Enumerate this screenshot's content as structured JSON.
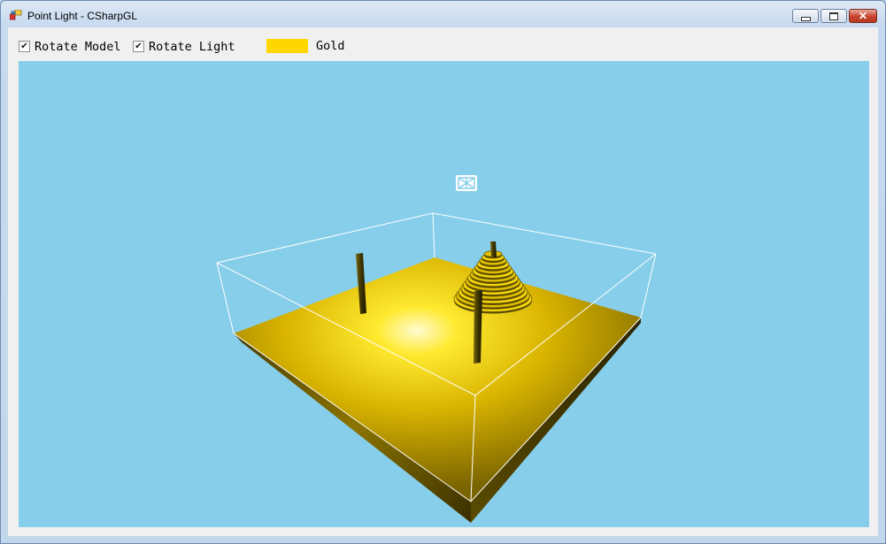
{
  "window": {
    "title": "Point Light - CSharpGL"
  },
  "controls": {
    "rotate_model": {
      "label": "Rotate Model",
      "checked": true
    },
    "rotate_light": {
      "label": "Rotate Light",
      "checked": true
    },
    "color": {
      "label": "Gold",
      "swatch": "#ffd700"
    }
  },
  "scene": {
    "background_color": "#87ceea",
    "model_color": "#ffd700",
    "light_color": "#ffffff",
    "rings": 14
  }
}
